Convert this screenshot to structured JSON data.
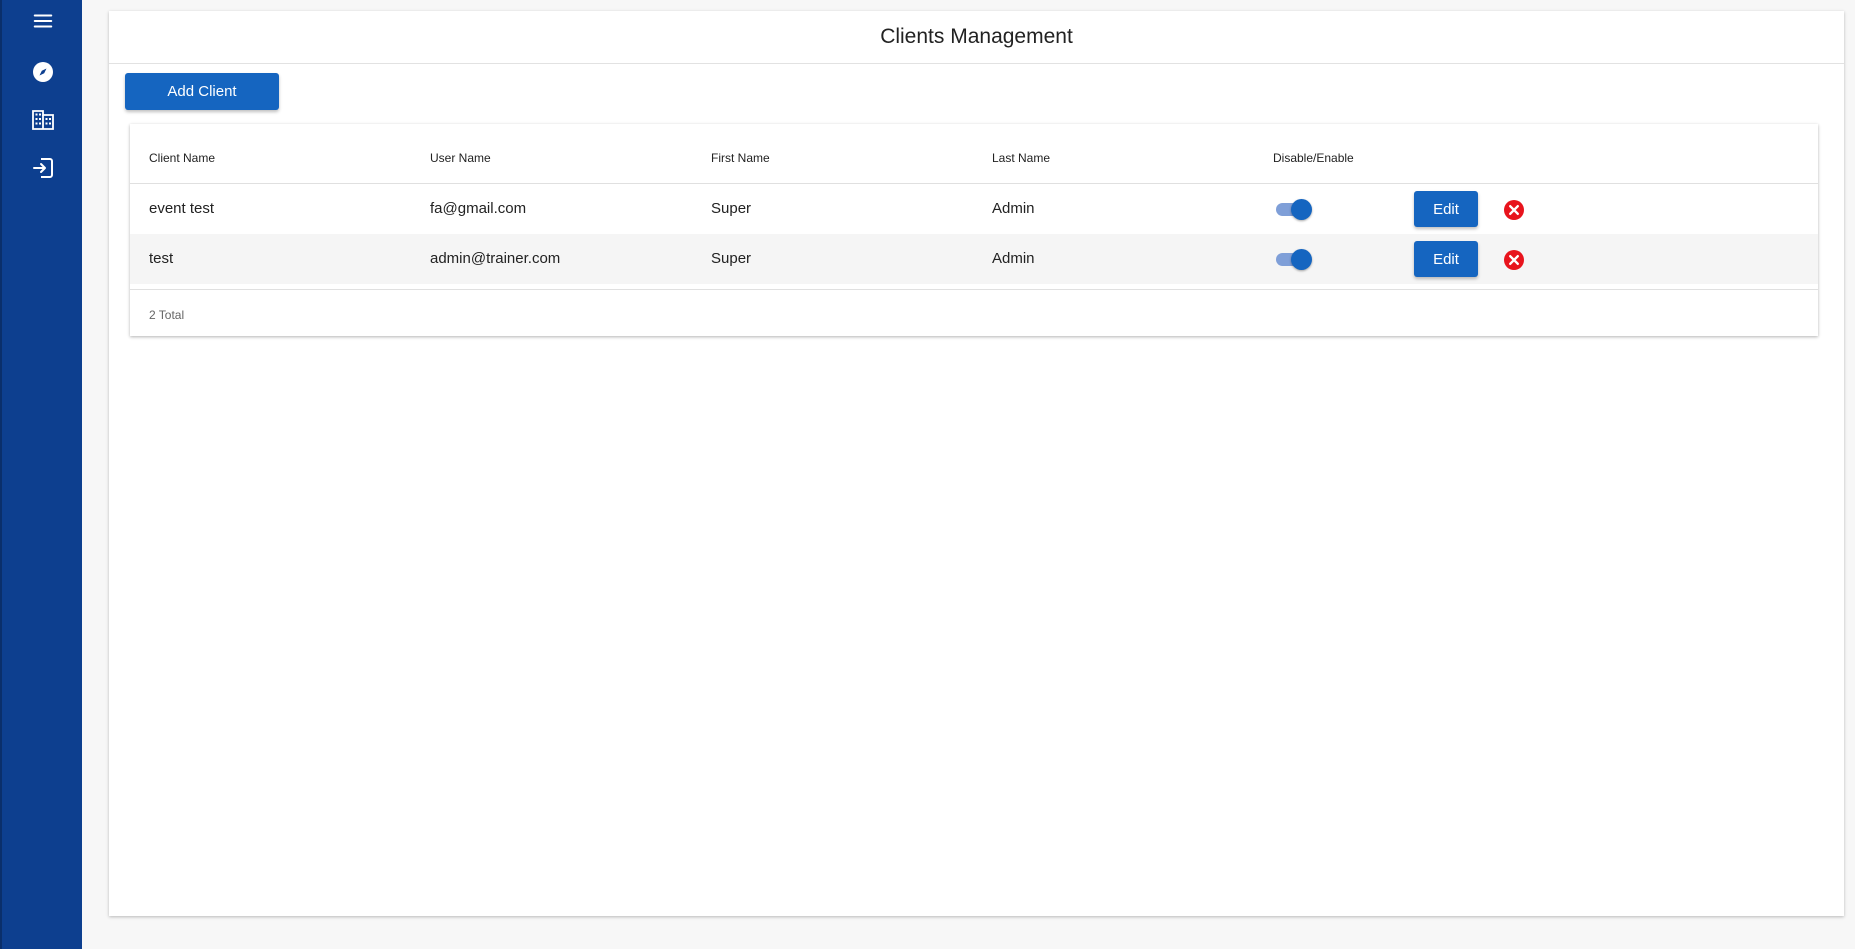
{
  "sidebar": {
    "items": [
      {
        "icon": "menu-icon"
      },
      {
        "icon": "compass-icon"
      },
      {
        "icon": "building-icon"
      },
      {
        "icon": "logout-icon"
      }
    ],
    "color": "#0d3f8f"
  },
  "page": {
    "title": "Clients Management",
    "add_button_label": "Add Client"
  },
  "table": {
    "headers": {
      "client_name": "Client Name",
      "user_name": "User Name",
      "first_name": "First Name",
      "last_name": "Last Name",
      "toggle": "Disable/Enable"
    },
    "rows": [
      {
        "client_name": "event test",
        "user_name": "fa@gmail.com",
        "first_name": "Super",
        "last_name": "Admin",
        "enabled": true,
        "edit_label": "Edit"
      },
      {
        "client_name": "test",
        "user_name": "admin@trainer.com",
        "first_name": "Super",
        "last_name": "Admin",
        "enabled": true,
        "edit_label": "Edit"
      }
    ],
    "total_text": "2 Total"
  },
  "colors": {
    "primary": "#1565c0",
    "delete": "#e8141d"
  }
}
